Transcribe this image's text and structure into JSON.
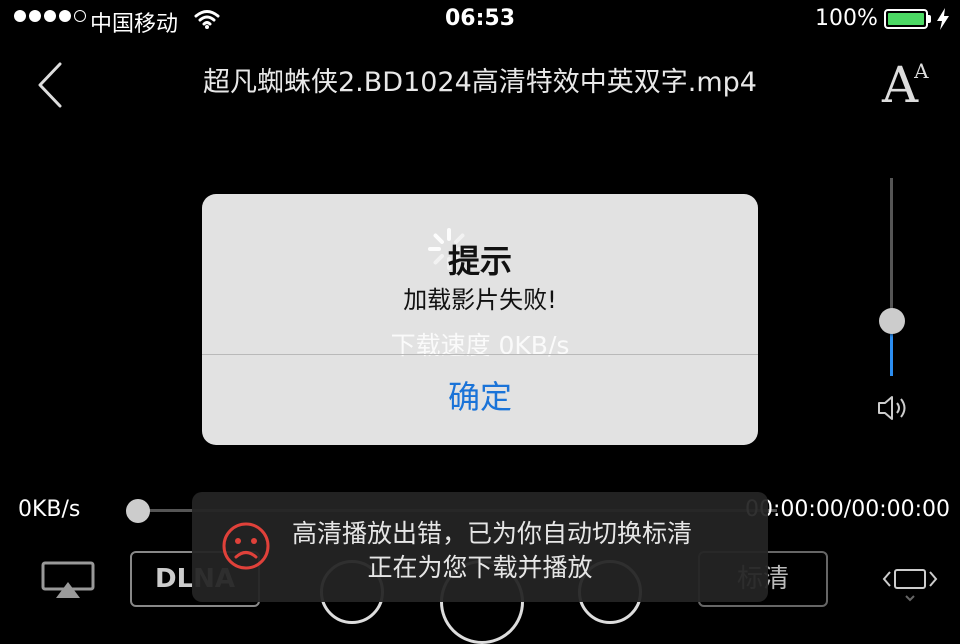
{
  "status_bar": {
    "carrier": "中国移动",
    "time": "06:53",
    "battery_percent": "100%",
    "battery_level": 1.0,
    "signal_bars": 4,
    "icons": [
      "signal-dots-icon",
      "wifi-icon",
      "battery-icon",
      "charging-bolt-icon"
    ]
  },
  "nav": {
    "title": "超凡蜘蛛侠2.BD1024高清特效中英双字.mp4",
    "back_icon": "chevron-left-icon",
    "font_icon": {
      "big": "A",
      "small": "A"
    }
  },
  "alert": {
    "title": "提示",
    "message": "加载影片失败!",
    "download_speed": "下载速度 0KB/s",
    "ok_label": "确定"
  },
  "player": {
    "speed": "0KB/s",
    "time": "00:00:00/00:00:00",
    "progress": 0.0,
    "volume": 0.28,
    "dlna_label": "DLNA",
    "quality_label": "标清"
  },
  "toast": {
    "line1": "高清播放出错，已为你自动切换标清",
    "line2": "正在为您下载并播放",
    "icon": "sad-face-icon"
  },
  "colors": {
    "accent": "#1a73d8",
    "battery": "#4cd964",
    "volume_fill": "#2c8ef0",
    "toast_icon": "#e0413a"
  }
}
